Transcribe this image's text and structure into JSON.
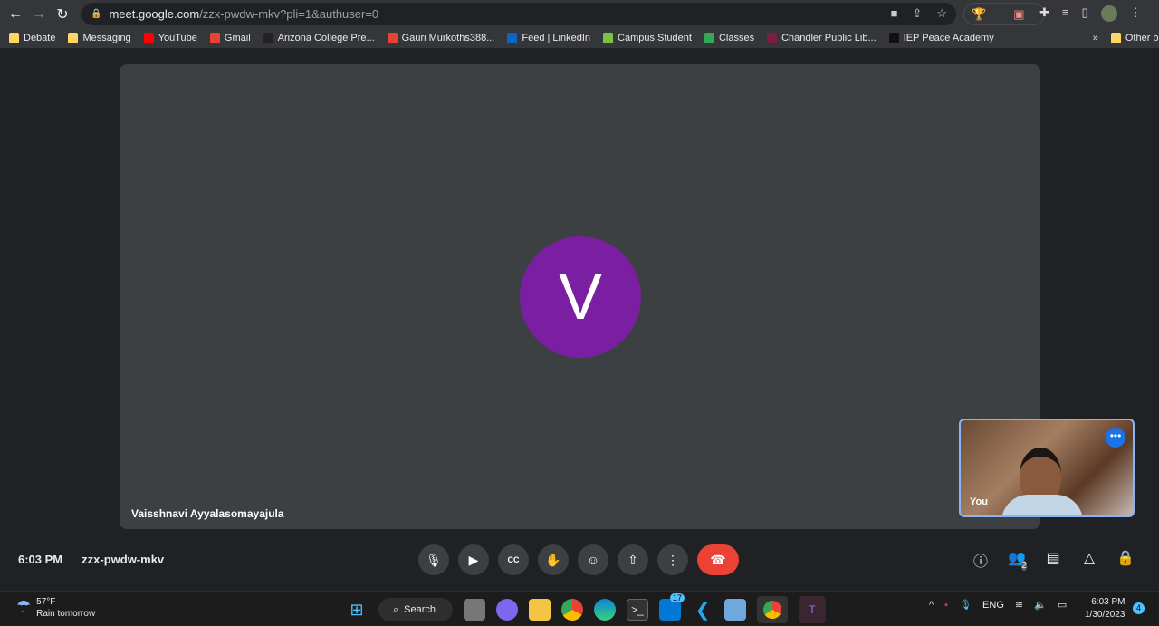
{
  "browser": {
    "url_host": "meet.google.com",
    "url_path": "/zzx-pwdw-mkv?pli=1&authuser=0"
  },
  "bookmarks": [
    {
      "label": "Debate",
      "color": "#fdd663"
    },
    {
      "label": "Messaging",
      "color": "#fdd663"
    },
    {
      "label": "YouTube",
      "color": "#ff0000"
    },
    {
      "label": "Gmail",
      "color": "#ea4335"
    },
    {
      "label": "Arizona College Pre...",
      "color": "#222222"
    },
    {
      "label": "Gauri Murkoths388...",
      "color": "#ea4335"
    },
    {
      "label": "Feed | LinkedIn",
      "color": "#0a66c2"
    },
    {
      "label": "Campus Student",
      "color": "#7cc242"
    },
    {
      "label": "Classes",
      "color": "#34a853"
    },
    {
      "label": "Chandler Public Lib...",
      "color": "#7a1f3d"
    },
    {
      "label": "IEP Peace Academy",
      "color": "#111111"
    }
  ],
  "other_bookmarks": "Other bookmarks",
  "meeting": {
    "participant_initial": "V",
    "participant_name": "Vaisshnavi Ayyalasomayajula",
    "avatar_color": "#7b1fa2",
    "self_label": "You",
    "time": "6:03 PM",
    "code": "zzx-pwdw-mkv",
    "people_count": "2",
    "end_color": "#ea4335"
  },
  "taskbar": {
    "temp": "57°F",
    "forecast": "Rain tomorrow",
    "search": "Search",
    "mail_badge": "17",
    "lang": "ENG",
    "time": "6:03 PM",
    "date": "1/30/2023",
    "notifications": "4"
  }
}
